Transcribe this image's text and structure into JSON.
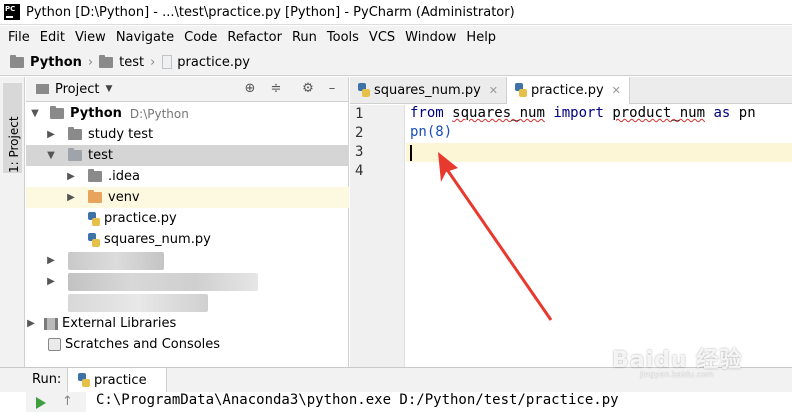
{
  "window": {
    "title": "Python [D:\\Python] - ...\\test\\practice.py [Python] - PyCharm (Administrator)",
    "logo_text": "PC"
  },
  "menubar": {
    "items": [
      {
        "label": "File"
      },
      {
        "label": "Edit"
      },
      {
        "label": "View"
      },
      {
        "label": "Navigate"
      },
      {
        "label": "Code"
      },
      {
        "label": "Refactor"
      },
      {
        "label": "Run"
      },
      {
        "label": "Tools"
      },
      {
        "label": "VCS"
      },
      {
        "label": "Window"
      },
      {
        "label": "Help"
      }
    ]
  },
  "breadcrumb": {
    "items": [
      "Python",
      "test",
      "practice.py"
    ]
  },
  "sidestrip": {
    "project_tab": "1: Project"
  },
  "project_panel": {
    "title": "Project",
    "tree": {
      "root_name": "Python",
      "root_path": "D:\\Python",
      "study_test": "study test",
      "test": "test",
      "idea": ".idea",
      "venv": "venv",
      "practice": "practice.py",
      "squares": "squares_num.py",
      "external_libraries": "External Libraries",
      "scratches": "Scratches and Consoles"
    }
  },
  "editor": {
    "tabs": [
      {
        "label": "squares_num.py",
        "active": false
      },
      {
        "label": "practice.py",
        "active": true
      }
    ],
    "line_numbers": [
      "1",
      "2",
      "3",
      "4"
    ],
    "lines": {
      "l1_from": "from",
      "l1_module": "squares_num",
      "l1_import": "import",
      "l1_name": "product_num",
      "l1_as": "as",
      "l1_alias": "pn",
      "l2": "pn(8)"
    },
    "current_line": 3
  },
  "run_panel": {
    "label": "Run:",
    "tab_label": "practice",
    "output": "C:\\ProgramData\\Anaconda3\\python.exe D:/Python/test/practice.py"
  },
  "watermark": {
    "text": "Baidu 经验",
    "sub": "jingyan.baidu.com"
  },
  "colors": {
    "accent_arrow": "#e8392f",
    "current_line": "#fcf5d6",
    "keyword": "#000080",
    "selected_row": "#d5d5d5"
  }
}
